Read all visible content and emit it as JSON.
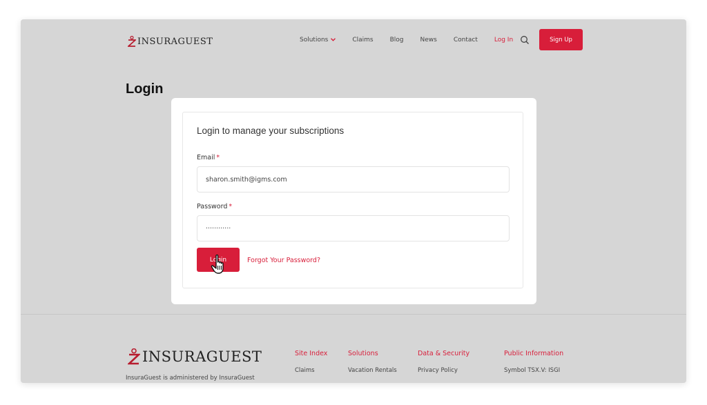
{
  "colors": {
    "accent": "#d81e3a",
    "background": "#d6d6d6"
  },
  "header": {
    "logo_text": "INSURAGUEST",
    "nav": {
      "solutions": "Solutions",
      "claims": "Claims",
      "blog": "Blog",
      "news": "News",
      "contact": "Contact",
      "login": "Log In"
    },
    "signup_label": "Sign Up"
  },
  "page": {
    "title": "Login"
  },
  "form": {
    "heading": "Login to manage your subscriptions",
    "email_label": "Email",
    "email_value": "sharon.smith@igms.com",
    "password_label": "Password",
    "password_value": "············",
    "required_mark": "*",
    "login_button": "Login",
    "forgot_link": "Forgot Your Password?"
  },
  "footer": {
    "logo_text": "INSURAGUEST",
    "tagline": "InsuraGuest is administered by InsuraGuest",
    "columns": [
      {
        "heading": "Site Index",
        "first_link": "Claims"
      },
      {
        "heading": "Solutions",
        "first_link": "Vacation Rentals"
      },
      {
        "heading": "Data & Security",
        "first_link": "Privacy Policy"
      },
      {
        "heading": "Public Information",
        "first_link": "Symbol TSX.V:  ISGI"
      }
    ]
  },
  "icons": [
    "logo-icon",
    "chevron-down-icon",
    "search-icon",
    "hand-cursor-icon"
  ]
}
